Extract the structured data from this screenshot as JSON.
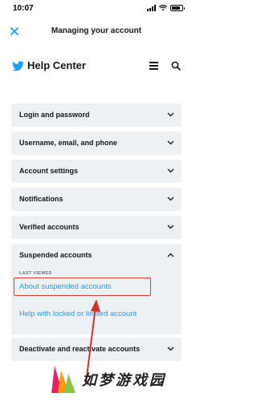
{
  "status_bar": {
    "time": "10:07"
  },
  "nav": {
    "title": "Managing your account",
    "close_icon": "close-icon"
  },
  "help_header": {
    "title": "Help Center",
    "brand_color": "#1da1f2"
  },
  "accordion": {
    "items": [
      {
        "label": "Login and password",
        "state": "collapsed"
      },
      {
        "label": "Username, email, and phone",
        "state": "collapsed"
      },
      {
        "label": "Account settings",
        "state": "collapsed"
      },
      {
        "label": "Notifications",
        "state": "collapsed"
      },
      {
        "label": "Verified accounts",
        "state": "collapsed"
      }
    ],
    "expanded": {
      "label": "Suspended accounts",
      "state": "expanded",
      "last_viewed_tag": "LAST VIEWED",
      "links": [
        {
          "label": "About suspended accounts",
          "highlighted": true
        },
        {
          "label": "Help with locked or limited account",
          "highlighted": false
        }
      ]
    },
    "after": [
      {
        "label": "Deactivate and reactivate accounts",
        "state": "collapsed"
      }
    ]
  },
  "annotation": {
    "highlight_color": "#e53935"
  },
  "watermark": {
    "text": "如梦游戏园"
  }
}
